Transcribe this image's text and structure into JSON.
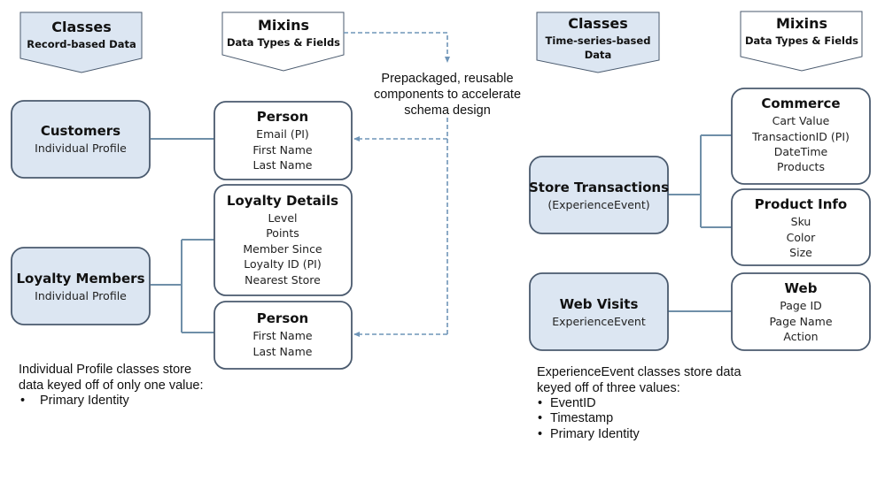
{
  "colors": {
    "class_fill": "#dce6f2",
    "class_border": "#4a5a6e",
    "mixin_fill": "#ffffff",
    "connector": "#6f8fa8",
    "dashed_arrow": "#6f95b8"
  },
  "headers": {
    "record_classes": {
      "title": "Classes",
      "subtitle": "Record-based Data"
    },
    "record_mixins": {
      "title": "Mixins",
      "subtitle": "Data Types & Fields"
    },
    "timeseries_classes": {
      "title": "Classes",
      "subtitle_line1": "Time-series-based",
      "subtitle_line2": "Data"
    },
    "timeseries_mixins": {
      "title": "Mixins",
      "subtitle": "Data Types & Fields"
    }
  },
  "callout": {
    "lines": [
      "Prepackaged, reusable",
      "components to accelerate",
      "schema design"
    ]
  },
  "classes": {
    "customers": {
      "title": "Customers",
      "subtitle": "Individual Profile"
    },
    "loyalty_members": {
      "title": "Loyalty Members",
      "subtitle": "Individual Profile"
    },
    "store_transactions": {
      "title": "Store Transactions",
      "subtitle": "(ExperienceEvent)"
    },
    "web_visits": {
      "title": "Web Visits",
      "subtitle": "ExperienceEvent"
    }
  },
  "mixins": {
    "person_customers": {
      "title": "Person",
      "fields": [
        "Email (PI)",
        "First Name",
        "Last Name"
      ]
    },
    "loyalty_details": {
      "title": "Loyalty Details",
      "fields": [
        "Level",
        "Points",
        "Member Since",
        "Loyalty ID (PI)",
        "Nearest Store"
      ]
    },
    "person_loyalty": {
      "title": "Person",
      "fields": [
        "First Name",
        "Last Name"
      ]
    },
    "commerce": {
      "title": "Commerce",
      "fields": [
        "Cart Value",
        "TransactionID (PI)",
        "DateTime",
        "Products"
      ]
    },
    "product_info": {
      "title": "Product Info",
      "fields": [
        "Sku",
        "Color",
        "Size"
      ]
    },
    "web": {
      "title": "Web",
      "fields": [
        "Page ID",
        "Page Name",
        "Action"
      ]
    }
  },
  "notes": {
    "individual_profile": {
      "lines": [
        "Individual Profile classes store",
        "data keyed off of only one value:"
      ],
      "bullets": [
        "Primary Identity"
      ]
    },
    "experience_event": {
      "lines": [
        "ExperienceEvent classes store data",
        "keyed off of three values:"
      ],
      "bullets": [
        "EventID",
        "Timestamp",
        "Primary Identity"
      ]
    }
  }
}
